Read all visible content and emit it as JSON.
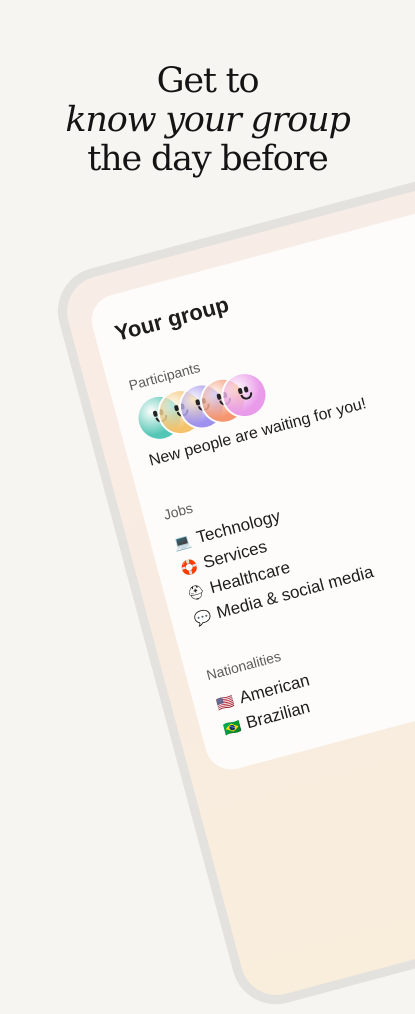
{
  "headline": {
    "line1": "Get to",
    "line2": "know your group",
    "line3": "the day before"
  },
  "card": {
    "title": "Your group",
    "participants": {
      "label": "Participants",
      "avatar_colors": [
        "#53c6b5",
        "#f3c26a",
        "#9f92ee",
        "#f59670",
        "#e99bea"
      ],
      "message": "New people are waiting for you!"
    },
    "jobs": {
      "label": "Jobs",
      "items": [
        {
          "icon": "💻",
          "icon_name": "laptop-icon",
          "label": "Technology"
        },
        {
          "icon": "🛟",
          "icon_name": "lifebuoy-icon",
          "label": "Services"
        },
        {
          "icon": "⛑",
          "icon_name": "rescue-helmet-icon",
          "label": "Healthcare"
        },
        {
          "icon": "💬",
          "icon_name": "speech-bubble-icon",
          "label": "Media & social media"
        }
      ]
    },
    "nationalities": {
      "label": "Nationalities",
      "items": [
        {
          "icon": "🇺🇸",
          "icon_name": "us-flag-icon",
          "label": "American"
        },
        {
          "icon": "🇧🇷",
          "icon_name": "brazil-flag-icon",
          "label": "Brazilian"
        }
      ]
    }
  }
}
